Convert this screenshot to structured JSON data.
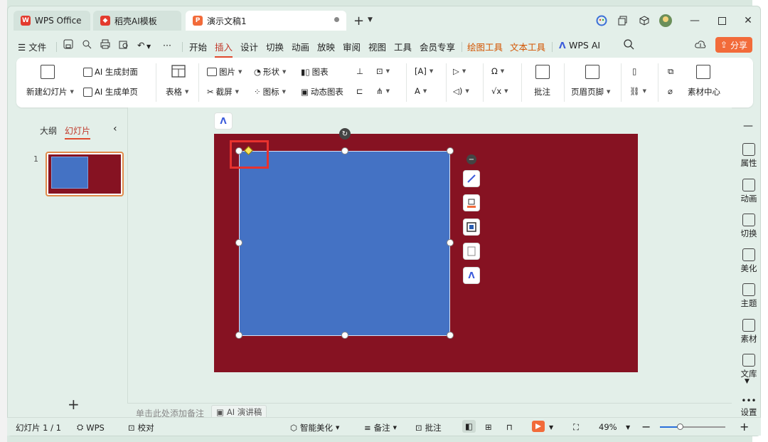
{
  "tabs": [
    {
      "label": "WPS Office"
    },
    {
      "label": "稻壳AI模板"
    },
    {
      "label": "演示文稿1"
    }
  ],
  "menu": {
    "items": [
      "文件",
      "开始",
      "插入",
      "设计",
      "切换",
      "动画",
      "放映",
      "审阅",
      "视图",
      "工具",
      "会员专享",
      "绘图工具",
      "文本工具",
      "WPS AI"
    ],
    "active": "插入",
    "share": "分享"
  },
  "ribbon": {
    "new_slide": "新建幻灯片",
    "ai_cover": "AI 生成封面",
    "ai_single": "AI 生成单页",
    "table": "表格",
    "picture": "图片",
    "screenshot": "截屏",
    "shape": "形状",
    "icon": "图标",
    "chart": "图表",
    "dynamic_chart": "动态图表",
    "comment": "批注",
    "header_footer": "页眉页脚",
    "material": "素材中心"
  },
  "left_panel": {
    "tab_outline": "大纲",
    "tab_slides": "幻灯片",
    "slide_number": "1",
    "add": "+"
  },
  "notes": {
    "placeholder": "单击此处添加备注",
    "ai_speech": "AI 演讲稿"
  },
  "right_sidebar": [
    "属性",
    "动画",
    "切换",
    "美化",
    "主题",
    "素材",
    "文库",
    "设置"
  ],
  "status": {
    "slide_info": "幻灯片 1 / 1",
    "wps": "WPS",
    "proofread": "校对",
    "smart_beautify": "智能美化",
    "notes": "备注",
    "comments": "批注",
    "zoom": "49%",
    "zoom_level": 0.3
  },
  "colors": {
    "slide_bg": "#861222",
    "shape_fill": "#4472c4",
    "accent": "#e04a2e",
    "highlight_box": "#e8322e"
  }
}
